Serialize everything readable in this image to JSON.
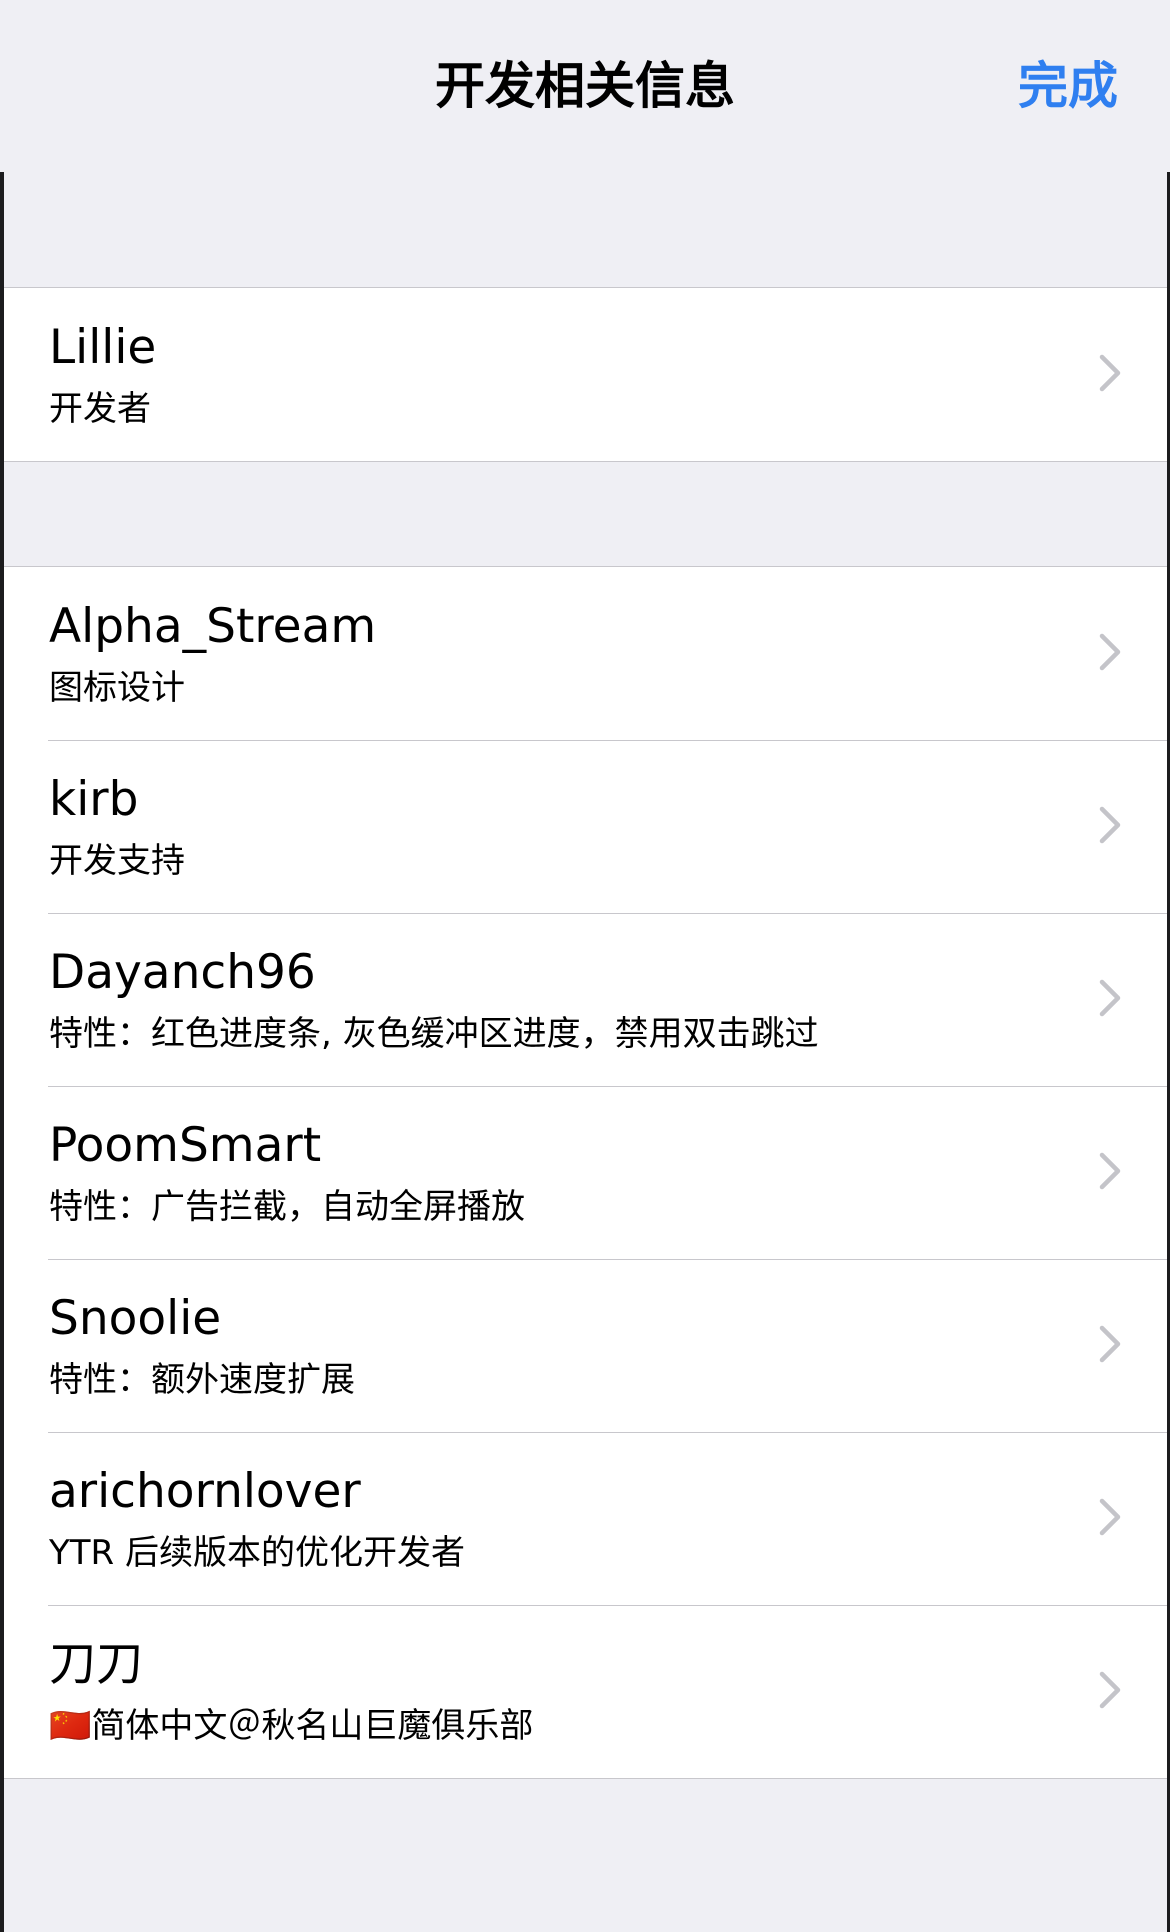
{
  "nav": {
    "title": "开发相关信息",
    "done_label": "完成",
    "accent_color": "#2f7ff0"
  },
  "group1": [
    {
      "name": "Lillie",
      "role": "开发者"
    }
  ],
  "group2": [
    {
      "name": "Alpha_Stream",
      "role": "图标设计"
    },
    {
      "name": "kirb",
      "role": "开发支持"
    },
    {
      "name": "Dayanch96",
      "role": "特性：红色进度条, 灰色缓冲区进度，禁用双击跳过"
    },
    {
      "name": "PoomSmart",
      "role": "特性：广告拦截，自动全屏播放"
    },
    {
      "name": "Snoolie",
      "role": "特性：额外速度扩展"
    },
    {
      "name": "arichornlover",
      "role": "YTR 后续版本的优化开发者"
    },
    {
      "name": "刀刀",
      "role": "🇨🇳简体中文＠秋名山巨魔俱乐部"
    }
  ],
  "icons": {
    "row_disclosure": "chevron-right-icon"
  }
}
